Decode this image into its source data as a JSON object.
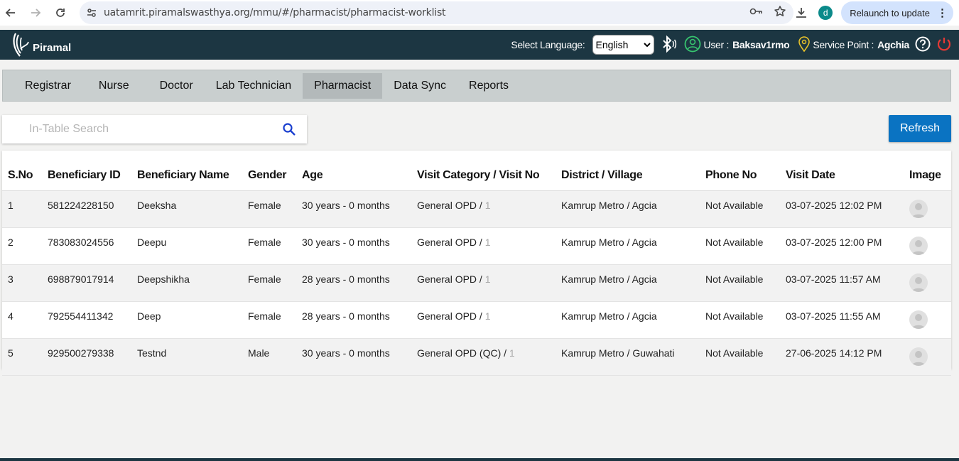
{
  "browser": {
    "url": "uatamrit.piramalswasthya.org/mmu/#/pharmacist/pharmacist-worklist",
    "profile_initial": "d",
    "relaunch_label": "Relaunch to update"
  },
  "header": {
    "brand": "Piramal",
    "language_label": "Select Language:",
    "language_value": "English",
    "user_label": "User :",
    "user_value": "Baksav1rmo",
    "service_point_label": "Service Point :",
    "service_point_value": "Agchia"
  },
  "tabs": [
    {
      "label": "Registrar"
    },
    {
      "label": "Nurse"
    },
    {
      "label": "Doctor"
    },
    {
      "label": "Lab Technician"
    },
    {
      "label": "Pharmacist"
    },
    {
      "label": "Data Sync"
    },
    {
      "label": "Reports"
    }
  ],
  "search": {
    "placeholder": "In-Table Search"
  },
  "refresh_label": "Refresh",
  "table": {
    "columns": [
      "S.No",
      "Beneficiary ID",
      "Beneficiary Name",
      "Gender",
      "Age",
      "Visit Category / Visit No",
      "District / Village",
      "Phone No",
      "Visit Date",
      "Image"
    ],
    "rows": [
      {
        "sno": "1",
        "id": "581224228150",
        "name": "Deeksha",
        "gender": "Female",
        "age": "30 years - 0 months",
        "category": "General OPD /",
        "visit_no": "1",
        "district": "Kamrup Metro / Agcia",
        "phone": "Not Available",
        "date": "03-07-2025 12:02 PM"
      },
      {
        "sno": "2",
        "id": "783083024556",
        "name": "Deepu",
        "gender": "Female",
        "age": "30 years - 0 months",
        "category": "General OPD /",
        "visit_no": "1",
        "district": "Kamrup Metro / Agcia",
        "phone": "Not Available",
        "date": "03-07-2025 12:00 PM"
      },
      {
        "sno": "3",
        "id": "698879017914",
        "name": "Deepshikha",
        "gender": "Female",
        "age": "28 years - 0 months",
        "category": "General OPD /",
        "visit_no": "1",
        "district": "Kamrup Metro / Agcia",
        "phone": "Not Available",
        "date": "03-07-2025 11:57 AM"
      },
      {
        "sno": "4",
        "id": "792554411342",
        "name": "Deep",
        "gender": "Female",
        "age": "28 years - 0 months",
        "category": "General OPD /",
        "visit_no": "1",
        "district": "Kamrup Metro / Agcia",
        "phone": "Not Available",
        "date": "03-07-2025 11:55 AM"
      },
      {
        "sno": "5",
        "id": "929500279338",
        "name": "Testnd",
        "gender": "Male",
        "age": "30 years - 0 months",
        "category": "General OPD (QC) /",
        "visit_no": "1",
        "district": "Kamrup Metro / Guwahati",
        "phone": "Not Available",
        "date": "27-06-2025 14:12 PM"
      }
    ]
  },
  "colors": {
    "header_bg": "#1c3642",
    "accent_blue": "#0a73c2",
    "user_icon": "#37c46f",
    "location_icon": "#e8c22a",
    "power_icon": "#e53935"
  }
}
